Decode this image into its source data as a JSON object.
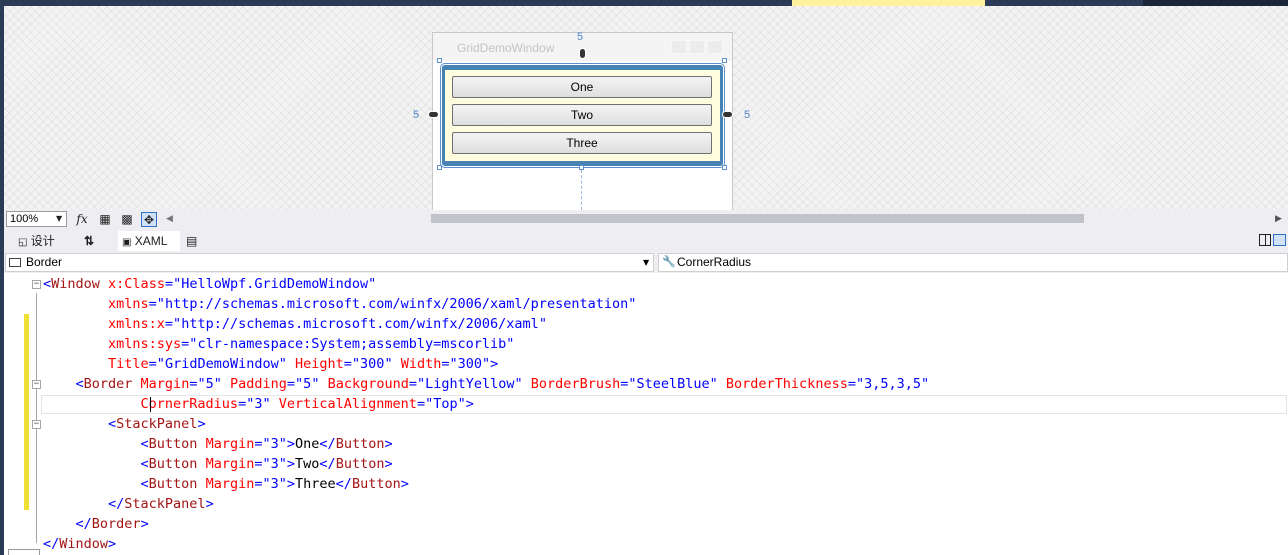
{
  "designer": {
    "window_title": "GridDemoWindow",
    "margin_top": "5",
    "margin_left": "5",
    "margin_right": "5",
    "buttons": [
      "One",
      "Two",
      "Three"
    ]
  },
  "zoom_toolbar": {
    "zoom_level": "100%",
    "fx_label": "fx"
  },
  "tabs": {
    "design_label": "设计",
    "swap_label": "⇅",
    "xaml_label": "XAML"
  },
  "navigation": {
    "element": "Border",
    "property": "CornerRadius"
  },
  "editor": {
    "lines": [
      {
        "parts": [
          [
            "b",
            "<"
          ],
          [
            "t",
            "Window"
          ],
          [
            "a",
            " x:Class"
          ],
          [
            "b",
            "=\""
          ],
          [
            "b",
            "HelloWpf.GridDemoWindow"
          ],
          [
            "b",
            "\""
          ]
        ]
      },
      {
        "parts": [
          [
            "a",
            "        xmlns"
          ],
          [
            "b",
            "=\""
          ],
          [
            "b",
            "http://schemas.microsoft.com/winfx/2006/xaml/presentation"
          ],
          [
            "b",
            "\""
          ]
        ]
      },
      {
        "parts": [
          [
            "a",
            "        xmlns:x"
          ],
          [
            "b",
            "=\""
          ],
          [
            "b",
            "http://schemas.microsoft.com/winfx/2006/xaml"
          ],
          [
            "b",
            "\""
          ]
        ]
      },
      {
        "parts": [
          [
            "a",
            "        xmlns:sys"
          ],
          [
            "b",
            "=\""
          ],
          [
            "b",
            "clr-namespace:System;assembly=mscorlib"
          ],
          [
            "b",
            "\""
          ]
        ]
      },
      {
        "parts": [
          [
            "a",
            "        Title"
          ],
          [
            "b",
            "=\""
          ],
          [
            "b",
            "GridDemoWindow"
          ],
          [
            "b",
            "\""
          ],
          [
            "a",
            " Height"
          ],
          [
            "b",
            "=\""
          ],
          [
            "b",
            "300"
          ],
          [
            "b",
            "\""
          ],
          [
            "a",
            " Width"
          ],
          [
            "b",
            "=\""
          ],
          [
            "b",
            "300"
          ],
          [
            "b",
            "\">"
          ]
        ]
      },
      {
        "parts": [
          [
            "b",
            "    <"
          ],
          [
            "t",
            "Border"
          ],
          [
            "a",
            " Margin"
          ],
          [
            "b",
            "=\""
          ],
          [
            "b",
            "5"
          ],
          [
            "b",
            "\""
          ],
          [
            "a",
            " Padding"
          ],
          [
            "b",
            "=\""
          ],
          [
            "b",
            "5"
          ],
          [
            "b",
            "\""
          ],
          [
            "a",
            " Background"
          ],
          [
            "b",
            "=\""
          ],
          [
            "b",
            "LightYellow"
          ],
          [
            "b",
            "\""
          ],
          [
            "a",
            " BorderBrush"
          ],
          [
            "b",
            "=\""
          ],
          [
            "b",
            "SteelBlue"
          ],
          [
            "b",
            "\""
          ],
          [
            "a",
            " BorderThickness"
          ],
          [
            "b",
            "=\""
          ],
          [
            "b",
            "3,5,3,5"
          ],
          [
            "b",
            "\""
          ]
        ]
      },
      {
        "parts": [
          [
            "a",
            "            CornerRadius"
          ],
          [
            "b",
            "=\""
          ],
          [
            "b",
            "3"
          ],
          [
            "b",
            "\""
          ],
          [
            "a",
            " VerticalAlignment"
          ],
          [
            "b",
            "=\""
          ],
          [
            "b",
            "Top"
          ],
          [
            "b",
            "\">"
          ]
        ]
      },
      {
        "parts": [
          [
            "b",
            "        <"
          ],
          [
            "t",
            "StackPanel"
          ],
          [
            "b",
            ">"
          ]
        ]
      },
      {
        "parts": [
          [
            "b",
            "            <"
          ],
          [
            "t",
            "Button"
          ],
          [
            "a",
            " Margin"
          ],
          [
            "b",
            "=\""
          ],
          [
            "b",
            "3"
          ],
          [
            "b",
            "\">"
          ],
          [
            "k",
            "One"
          ],
          [
            "b",
            "</"
          ],
          [
            "t",
            "Button"
          ],
          [
            "b",
            ">"
          ]
        ]
      },
      {
        "parts": [
          [
            "b",
            "            <"
          ],
          [
            "t",
            "Button"
          ],
          [
            "a",
            " Margin"
          ],
          [
            "b",
            "=\""
          ],
          [
            "b",
            "3"
          ],
          [
            "b",
            "\">"
          ],
          [
            "k",
            "Two"
          ],
          [
            "b",
            "</"
          ],
          [
            "t",
            "Button"
          ],
          [
            "b",
            ">"
          ]
        ]
      },
      {
        "parts": [
          [
            "b",
            "            <"
          ],
          [
            "t",
            "Button"
          ],
          [
            "a",
            " Margin"
          ],
          [
            "b",
            "=\""
          ],
          [
            "b",
            "3"
          ],
          [
            "b",
            "\">"
          ],
          [
            "k",
            "Three"
          ],
          [
            "b",
            "</"
          ],
          [
            "t",
            "Button"
          ],
          [
            "b",
            ">"
          ]
        ]
      },
      {
        "parts": [
          [
            "b",
            "        </"
          ],
          [
            "t",
            "StackPanel"
          ],
          [
            "b",
            ">"
          ]
        ]
      },
      {
        "parts": [
          [
            "b",
            "    </"
          ],
          [
            "t",
            "Border"
          ],
          [
            "b",
            ">"
          ]
        ]
      },
      {
        "parts": [
          [
            "b",
            "</"
          ],
          [
            "t",
            "Window"
          ],
          [
            "b",
            ">"
          ]
        ]
      }
    ]
  },
  "colors": {
    "border_brush": "#4682b4",
    "border_background": "#fffde0",
    "accent_yellow": "#eee034",
    "frame_dark": "#2b3a55"
  }
}
